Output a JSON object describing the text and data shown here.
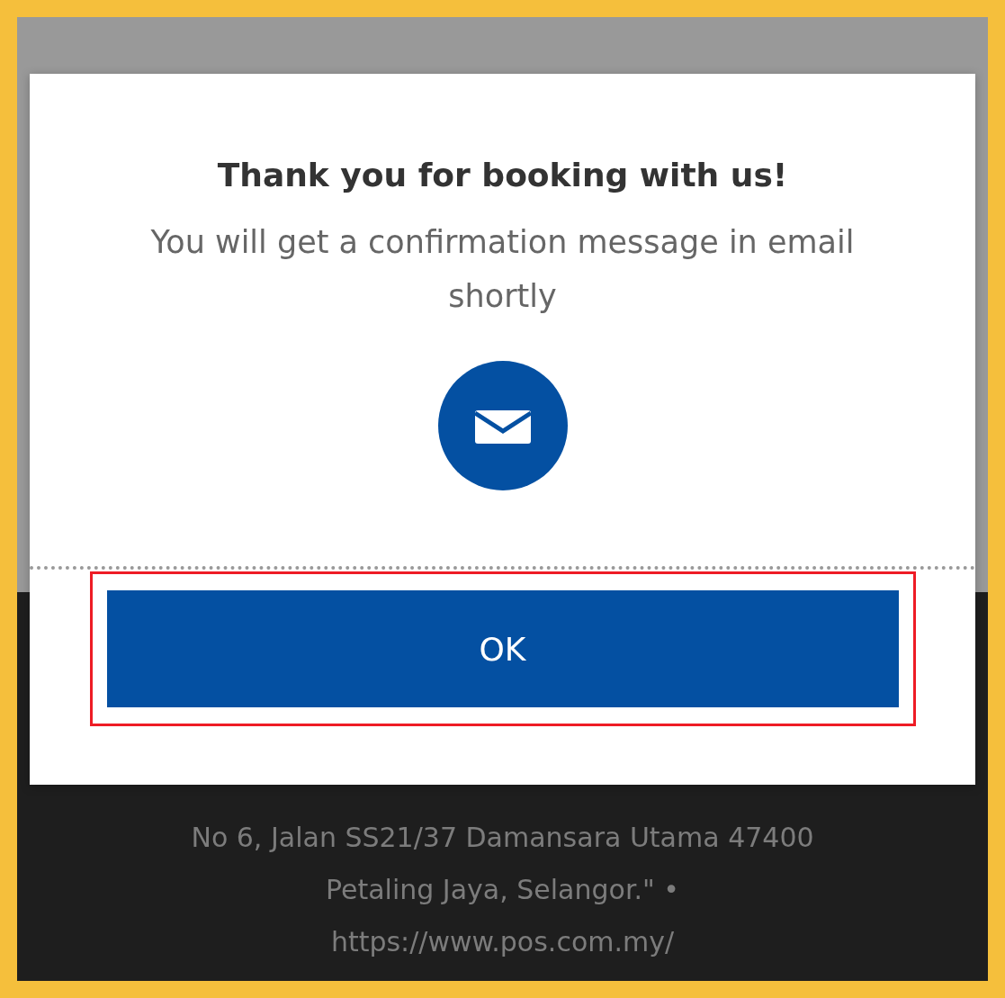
{
  "dialog": {
    "title": "Thank you for booking with us!",
    "message": "You will get a confirmation message in email shortly",
    "highlighted": true,
    "buttons": [
      {
        "label": "OK"
      }
    ]
  },
  "background": {
    "address": "No 6, Jalan SS21/37 Damansara Utama 47400 Petaling Jaya, Selangor.\" •",
    "url": "https://www.pos.com.my/"
  }
}
